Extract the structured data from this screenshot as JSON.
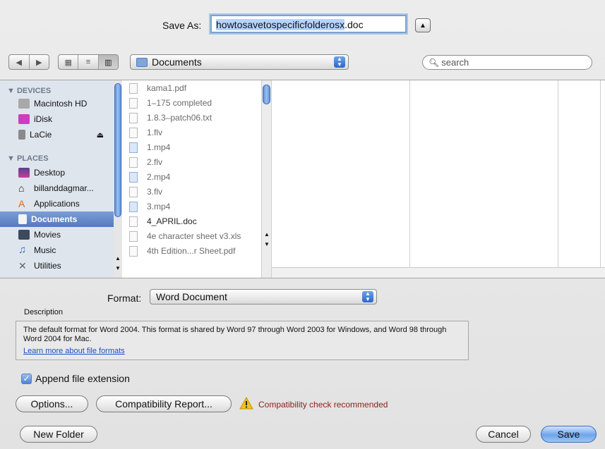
{
  "dialog": {
    "save_as_label": "Save As:",
    "filename_base": "howtosavetospecificfolderosx",
    "filename_ext": ".doc"
  },
  "toolbar": {
    "location": "Documents",
    "search_placeholder": "search"
  },
  "sidebar": {
    "devices_header": "▼ DEVICES",
    "places_header": "▼ PLACES",
    "devices": [
      {
        "label": "Macintosh HD",
        "icon": "hard-drive-icon"
      },
      {
        "label": "iDisk",
        "icon": "idisk-icon"
      },
      {
        "label": "LaCie",
        "icon": "external-drive-icon"
      }
    ],
    "places": [
      {
        "label": "Desktop",
        "icon": "desktop-icon"
      },
      {
        "label": "billanddagmar...",
        "icon": "home-icon"
      },
      {
        "label": "Applications",
        "icon": "applications-icon"
      },
      {
        "label": "Documents",
        "icon": "documents-icon",
        "selected": true
      },
      {
        "label": "Movies",
        "icon": "movies-icon"
      },
      {
        "label": "Music",
        "icon": "music-icon"
      },
      {
        "label": "Utilities",
        "icon": "utilities-icon"
      }
    ]
  },
  "files": [
    {
      "name": "kama1.pdf",
      "kind": "doc"
    },
    {
      "name": "1–175 completed",
      "kind": "doc"
    },
    {
      "name": "1.8.3–patch06.txt",
      "kind": "doc"
    },
    {
      "name": "1.flv",
      "kind": "doc"
    },
    {
      "name": "1.mp4",
      "kind": "media"
    },
    {
      "name": "2.flv",
      "kind": "doc"
    },
    {
      "name": "2.mp4",
      "kind": "media"
    },
    {
      "name": "3.flv",
      "kind": "doc"
    },
    {
      "name": "3.mp4",
      "kind": "media"
    },
    {
      "name": "4_APRIL.doc",
      "kind": "doc",
      "enabled": true
    },
    {
      "name": "4e character sheet v3.xls",
      "kind": "doc"
    },
    {
      "name": "4th Edition...r Sheet.pdf",
      "kind": "doc"
    }
  ],
  "format": {
    "label": "Format:",
    "value": "Word Document",
    "description_label": "Description",
    "description_text": "The default format for Word 2004. This format is shared by Word 97 through Word 2003 for Windows, and Word 98 through Word 2004 for Mac.",
    "link_text": "Learn more about file formats"
  },
  "options": {
    "append_extension_label": "Append file extension",
    "append_extension_checked": true,
    "options_button": "Options...",
    "compat_button": "Compatibility Report...",
    "compat_warning": "Compatibility check recommended"
  },
  "buttons": {
    "new_folder": "New Folder",
    "cancel": "Cancel",
    "save": "Save"
  },
  "colors": {
    "accent": "#5479bd",
    "warning_text": "#8b1f17",
    "link": "#1a4fc4"
  }
}
